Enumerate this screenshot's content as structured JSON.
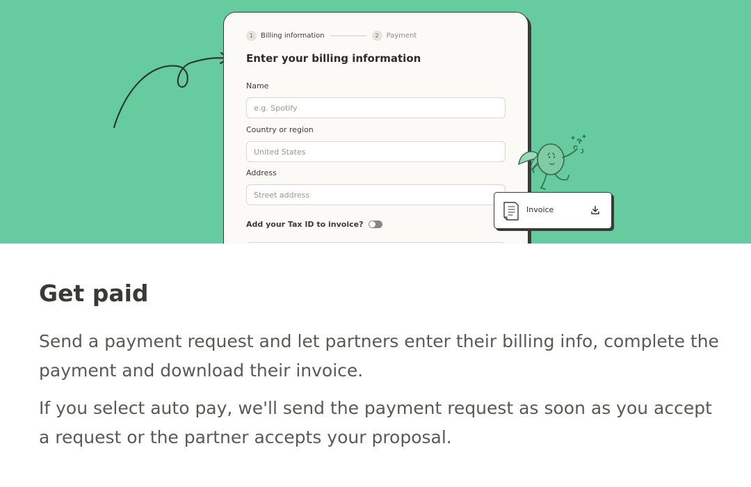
{
  "stepper": {
    "step1_number": "1",
    "step1_label": "Billing information",
    "step2_number": "2",
    "step2_label": "Payment"
  },
  "form": {
    "title": "Enter your billing information",
    "name_label": "Name",
    "name_placeholder": "e.g. Spotify",
    "country_label": "Country or region",
    "country_value": "United States",
    "address_label": "Address",
    "address_placeholder": "Street address",
    "tax_label": "Add your Tax ID to invoice?"
  },
  "invoice": {
    "label": "Invoice"
  },
  "content": {
    "heading": "Get paid",
    "paragraph1": "Send a payment request and let partners enter their billing info, complete the payment and download their invoice.",
    "paragraph2": "If you select auto pay, we'll send the payment request as soon as you accept a request or the partner accepts your proposal."
  },
  "colors": {
    "hero_background": "#66cc9f",
    "card_outline": "#3a3a36",
    "mascot": "#2f6b4f"
  },
  "icons": [
    "curved-arrow-icon",
    "document-icon",
    "download-icon",
    "mascot-illustration"
  ]
}
